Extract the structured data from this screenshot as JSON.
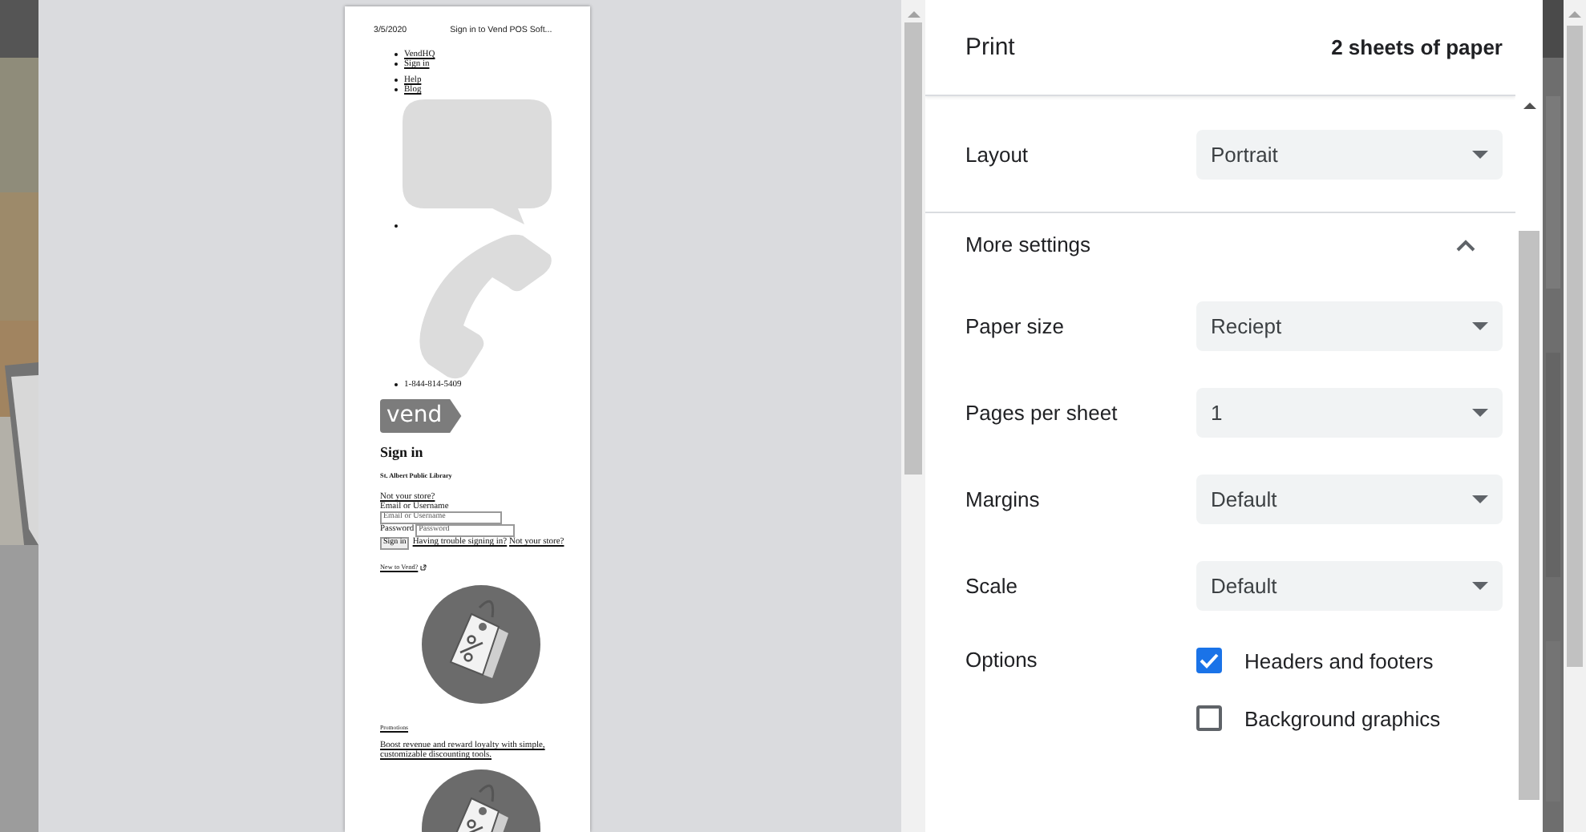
{
  "preview": {
    "page": {
      "header_date": "3/5/2020",
      "header_title": "Sign in to Vend POS Soft...",
      "nav_links": [
        "VendHQ",
        "Sign in"
      ],
      "help_links": [
        "Help",
        "Blog"
      ],
      "phone": "1-844-814-5409",
      "logo": "vend",
      "heading": "Sign in",
      "store": "St. Albert Public Library",
      "not_store_link": "Not your store?",
      "email_label": "Email or Username",
      "email_placeholder": "Email or Username",
      "password_label": "Password",
      "password_placeholder": "Password",
      "sign_in_button": "Sign in",
      "trouble_link": "Having trouble signing in?",
      "not_store_link_2": "Not your store?",
      "new_link": "New to Vend?",
      "promo_heading": "Promotions",
      "promo_text": "Boost revenue and reward loyalty with simple, customizable discounting tools."
    }
  },
  "settings": {
    "title": "Print",
    "sheets": "2 sheets of paper",
    "rows": [
      {
        "kind": "select",
        "label": "Layout",
        "value": "Portrait"
      },
      {
        "kind": "section",
        "label": "More settings",
        "expanded": true
      },
      {
        "kind": "select",
        "label": "Paper size",
        "value": "Reciept"
      },
      {
        "kind": "select",
        "label": "Pages per sheet",
        "value": "1"
      },
      {
        "kind": "select",
        "label": "Margins",
        "value": "Default"
      },
      {
        "kind": "select",
        "label": "Scale",
        "value": "Default"
      },
      {
        "kind": "checkboxes",
        "label": "Options",
        "options": [
          {
            "label": "Headers and footers",
            "checked": true
          },
          {
            "label": "Background graphics",
            "checked": false
          }
        ]
      }
    ]
  }
}
